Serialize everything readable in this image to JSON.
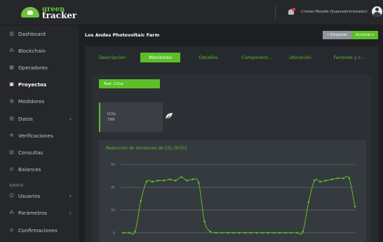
{
  "brand": {
    "line1": "green",
    "line2": "tracker"
  },
  "sidebar": {
    "items": [
      {
        "label": "Dashboard",
        "icon": "chart-icon",
        "glyph": "▥",
        "chevron": ""
      },
      {
        "label": "Blockchain",
        "icon": "blockchain-icon",
        "glyph": "⁂",
        "chevron": ""
      },
      {
        "label": "Operadores",
        "icon": "bar-chart-icon",
        "glyph": "▦",
        "chevron": ""
      },
      {
        "label": "Proyectos",
        "icon": "projects-icon",
        "glyph": "▣",
        "chevron": "",
        "active": true
      },
      {
        "label": "Medidores",
        "icon": "meter-icon",
        "glyph": "◍",
        "chevron": ""
      },
      {
        "label": "Datos",
        "icon": "data-icon",
        "glyph": "▤",
        "chevron": "›"
      },
      {
        "label": "Verificaciones",
        "icon": "verify-icon",
        "glyph": "✲",
        "chevron": ""
      },
      {
        "label": "Consultas",
        "icon": "queries-icon",
        "glyph": "▤",
        "chevron": ""
      },
      {
        "label": "Balances",
        "icon": "balance-icon",
        "glyph": "◎",
        "chevron": ""
      }
    ],
    "section_label": "AJENOS",
    "items2": [
      {
        "label": "Usuarios",
        "icon": "users-icon",
        "glyph": "☺",
        "chevron": "›"
      },
      {
        "label": "Parámetros",
        "icon": "params-icon",
        "glyph": "⁂",
        "chevron": "›"
      },
      {
        "label": "Confirmaciones",
        "icon": "confirm-icon",
        "glyph": "⊘",
        "chevron": ""
      }
    ]
  },
  "topbar": {
    "user_name": "Cristian Mosella (Superadministrador)"
  },
  "page": {
    "title": "Los Andes Photovoltaic Farm",
    "back_label": "« Proyectos",
    "actions_label": "Acciones ▾"
  },
  "tabs": [
    {
      "label": "Descripción"
    },
    {
      "label": "Monitoreo",
      "active": true
    },
    {
      "label": "Detalles"
    },
    {
      "label": "Component..."
    },
    {
      "label": "Ubicación"
    },
    {
      "label": "Factores y c..."
    }
  ],
  "subtab": {
    "label": "Red. CO₂e"
  },
  "stat": {
    "unit": "tCO₂",
    "value": "799"
  },
  "colors": {
    "accent": "#5cbf2a",
    "line": "#5cbf2a"
  },
  "chart_data": {
    "type": "line",
    "title": "Reducción de emisiones de CO₂ [tCO₂]",
    "yticks": [
      0,
      20,
      40,
      60
    ],
    "ylim": [
      -2,
      66
    ],
    "grid": true,
    "series": [
      {
        "values": [
          0,
          0,
          1,
          28,
          45,
          45,
          46,
          46,
          47,
          46,
          49,
          46,
          47,
          44,
          10,
          1,
          0,
          0,
          0,
          0,
          0,
          0,
          0,
          0,
          0,
          0,
          0,
          0,
          0,
          0,
          0,
          1,
          27,
          46,
          45,
          46,
          47,
          48,
          48,
          48,
          23
        ]
      }
    ]
  }
}
